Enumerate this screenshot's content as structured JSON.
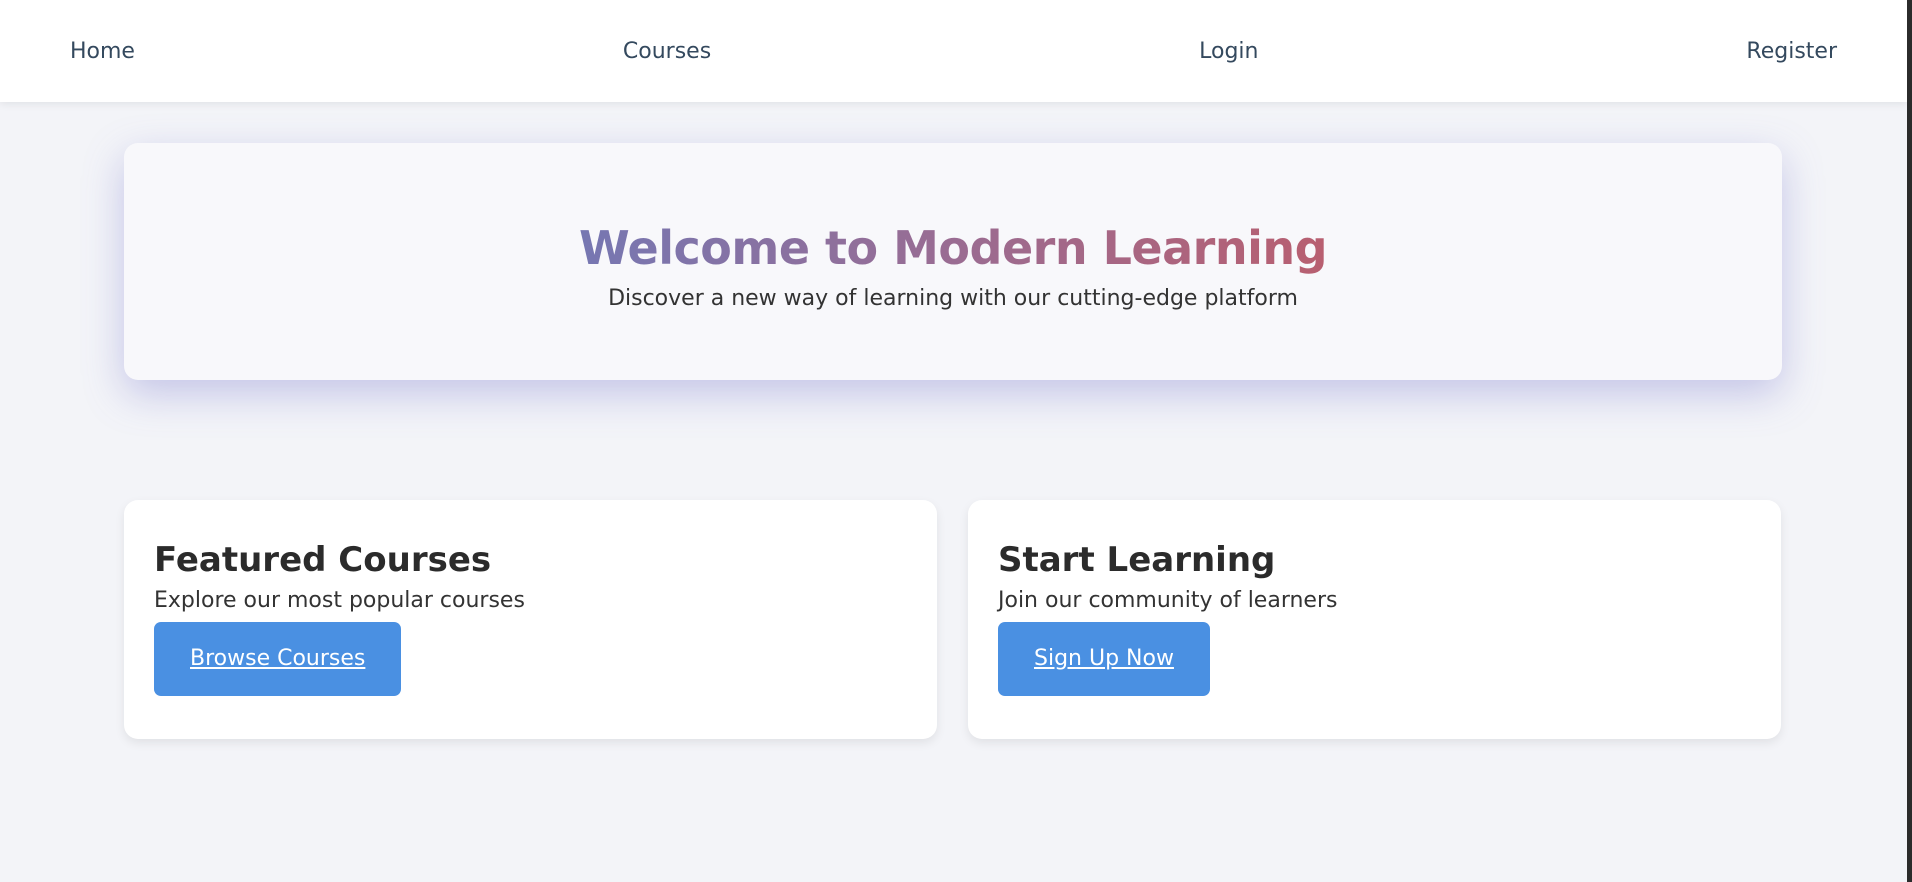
{
  "nav": {
    "items": [
      {
        "label": "Home"
      },
      {
        "label": "Courses"
      },
      {
        "label": "Login"
      },
      {
        "label": "Register"
      }
    ]
  },
  "hero": {
    "title": "Welcome to Modern Learning",
    "subtitle": "Discover a new way of learning with our cutting-edge platform"
  },
  "cards": [
    {
      "title": "Featured Courses",
      "text": "Explore our most popular courses",
      "button_label": "Browse Courses"
    },
    {
      "title": "Start Learning",
      "text": "Join our community of learners",
      "button_label": "Sign Up Now"
    }
  ],
  "colors": {
    "page_background": "#f3f4f8",
    "nav_background": "#ffffff",
    "nav_text": "#34495e",
    "button_background": "#4a90e2",
    "button_text": "#ffffff",
    "title_gradient_start": "#7677b2",
    "title_gradient_end": "#b85f70"
  }
}
